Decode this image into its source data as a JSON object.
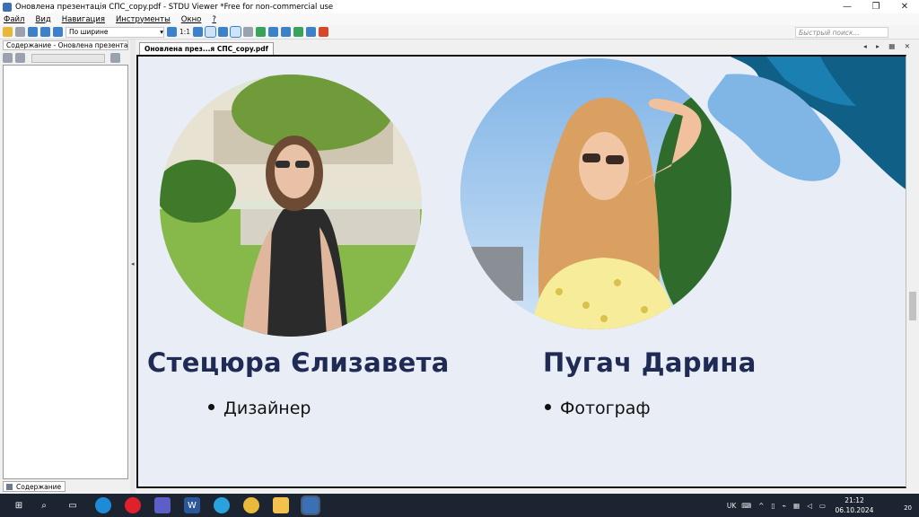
{
  "window": {
    "title": "Оновлена презентація СПС_copy.pdf - STDU Viewer *Free for non-commercial use",
    "minimize_glyph": "—",
    "maximize_glyph": "❐",
    "close_glyph": "✕"
  },
  "menu": {
    "items": [
      "Файл",
      "Вид",
      "Навигация",
      "Инструменты",
      "Окно",
      "?"
    ]
  },
  "toolbar": {
    "actual_size_label": "1:1",
    "zoom_value": "По ширине",
    "search_placeholder": "Быстрый поиск..."
  },
  "sidebar": {
    "header": "Содержание - Оновлена презентация",
    "footer_tab": "Содержание"
  },
  "document": {
    "tab_label": "Оновлена през...я СПС_copy.pdf",
    "tab_nav": "◂ ▸ ▦ ✕",
    "people": [
      {
        "name": "Стецюра Єлизавета",
        "role": "Дизайнер"
      },
      {
        "name": "Пугач Дарина",
        "role": "Фотограф"
      }
    ],
    "colors": {
      "background": "#e9edf5",
      "name_text": "#1f2a55",
      "blob_dark": "#0f5f86",
      "blob_light": "#7fb6e6"
    }
  },
  "taskbar": {
    "language": "UK",
    "time": "21:12",
    "date": "06.10.2024",
    "notification_count": "20",
    "apps": [
      "windows-start",
      "search",
      "task-view",
      "edge",
      "opera",
      "teams",
      "word",
      "telegram",
      "chrome",
      "file-explorer",
      "stdu-viewer"
    ]
  }
}
